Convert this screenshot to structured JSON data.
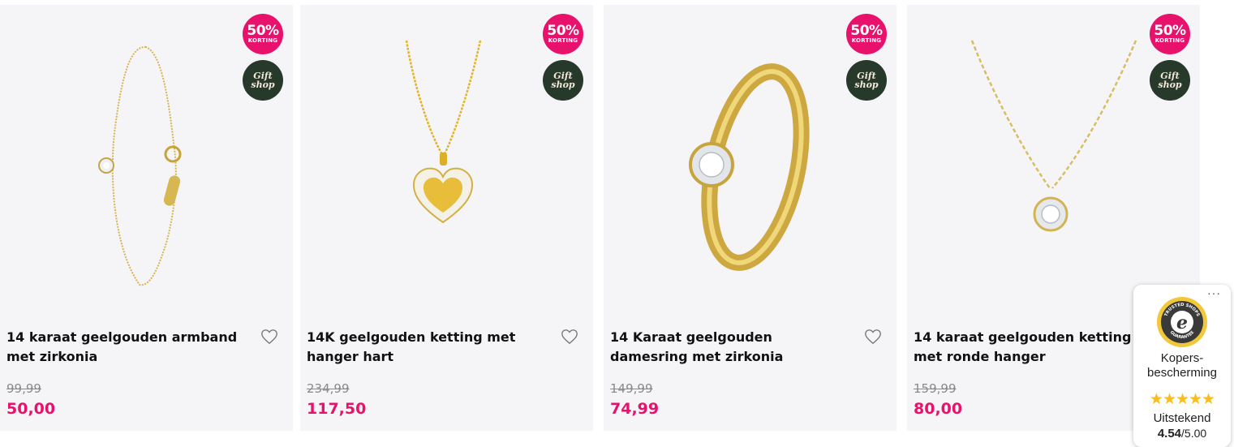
{
  "products": [
    {
      "title": "14 karaat geelgouden armband met zirkonia",
      "old_price": "99,99",
      "price": "50,00",
      "sale_pct": "50%",
      "sale_word": "KORTING",
      "gift_line1": "Gift",
      "gift_line2": "shop",
      "image": "gold-bracelet-zirconia"
    },
    {
      "title": "14K geelgouden ketting met hanger hart",
      "old_price": "234,99",
      "price": "117,50",
      "sale_pct": "50%",
      "sale_word": "KORTING",
      "gift_line1": "Gift",
      "gift_line2": "shop",
      "image": "gold-necklace-heart-pendant"
    },
    {
      "title": "14 Karaat geelgouden damesring met zirkonia",
      "old_price": "149,99",
      "price": "74,99",
      "sale_pct": "50%",
      "sale_word": "KORTING",
      "gift_line1": "Gift",
      "gift_line2": "shop",
      "image": "gold-ring-zirconia"
    },
    {
      "title": "14 karaat geelgouden ketting met ronde hanger",
      "old_price": "159,99",
      "price": "80,00",
      "sale_pct": "50%",
      "sale_word": "KORTING",
      "gift_line1": "Gift",
      "gift_line2": "shop",
      "image": "gold-necklace-round-pendant"
    }
  ],
  "trusted_shops": {
    "more": "···",
    "seal_top": "TRUSTED SHOPS",
    "seal_bottom": "GUARANTEE",
    "seal_letter": "e",
    "label": "Kopers-bescherming",
    "stars": "★★★★★",
    "rating_word": "Uitstekend",
    "score": "4.54",
    "score_max": "/5.00"
  },
  "colors": {
    "sale_pink": "#e8116b",
    "gift_green": "#27392a",
    "card_bg": "#f5f5f7",
    "gold": "#d8b64a",
    "star_yellow": "#f5bd1f"
  }
}
